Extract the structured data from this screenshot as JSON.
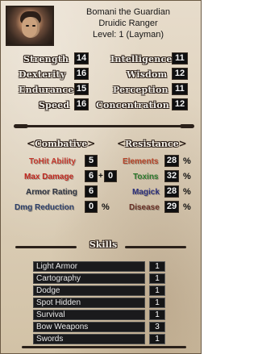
{
  "header": {
    "name": "Bomani the Guardian",
    "class": "Druidic Ranger",
    "level": "Level: 1 (Layman)"
  },
  "stats_left": [
    {
      "label": "Strength",
      "value": "14"
    },
    {
      "label": "Dexterity",
      "value": "16"
    },
    {
      "label": "Endurance",
      "value": "15"
    },
    {
      "label": "Speed",
      "value": "16"
    }
  ],
  "stats_right": [
    {
      "label": "Intelligence",
      "value": "11"
    },
    {
      "label": "Wisdom",
      "value": "12"
    },
    {
      "label": "Perception",
      "value": "11"
    },
    {
      "label": "Concentration",
      "value": "12"
    }
  ],
  "combat": {
    "title": "Combative",
    "tohit": {
      "label": "ToHit Ability",
      "value": "5"
    },
    "maxdmg": {
      "label": "Max Damage",
      "value": "6",
      "bonus": "0",
      "plus": "+"
    },
    "armor": {
      "label": "Armor Rating",
      "value": "6"
    },
    "dmgred": {
      "label": "Dmg Reduction",
      "value": "0",
      "unit": "%"
    }
  },
  "resistance": {
    "title": "Resistance",
    "items": [
      {
        "label": "Elements",
        "value": "28",
        "unit": "%"
      },
      {
        "label": "Toxins",
        "value": "32",
        "unit": "%"
      },
      {
        "label": "Magick",
        "value": "28",
        "unit": "%"
      },
      {
        "label": "Disease",
        "value": "29",
        "unit": "%"
      }
    ]
  },
  "skills": {
    "title": "Skills",
    "items": [
      {
        "name": "Light Armor",
        "value": "1"
      },
      {
        "name": "Cartography",
        "value": "1"
      },
      {
        "name": "Dodge",
        "value": "1"
      },
      {
        "name": "Spot Hidden",
        "value": "1"
      },
      {
        "name": "Survival",
        "value": "1"
      },
      {
        "name": "Bow Weapons",
        "value": "3"
      },
      {
        "name": "Swords",
        "value": "1"
      }
    ]
  },
  "decor": {
    "left_mark": "<",
    "right_mark": ">"
  },
  "colors": {
    "tohit": "#c63a2e",
    "maxdmg": "#c0281f",
    "armor": "#2e3442",
    "dmgred": "#2c3f6a",
    "elements": "#b6452a",
    "toxins": "#2d7a2d",
    "magick": "#2b2f7c",
    "disease": "#6a3126"
  }
}
